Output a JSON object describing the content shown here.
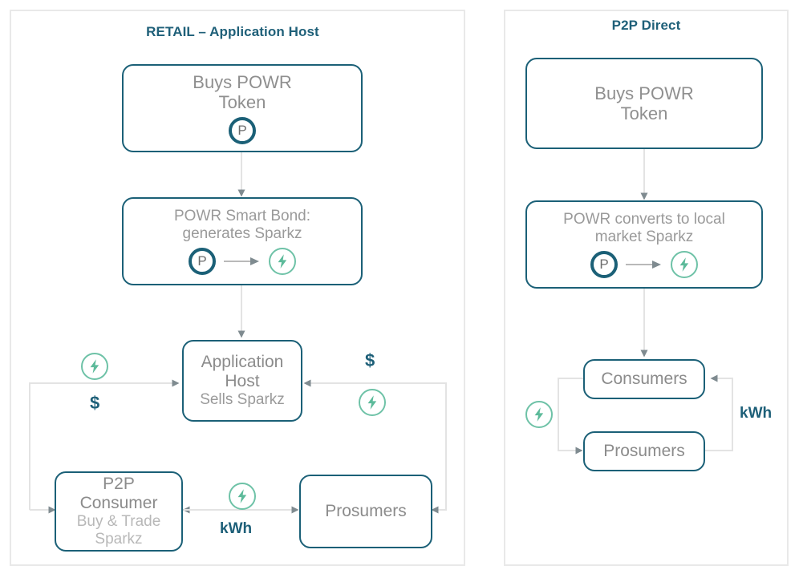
{
  "diagram": {
    "title_visible": false,
    "accent_dark_teal": "#1b6077",
    "accent_green": "#6ec2a7",
    "text_gray": "#8f8f8f",
    "text_gray_light": "#b4b4b4",
    "panel_border": "#e9e9e9"
  },
  "panels": [
    {
      "id": "retail",
      "title": "RETAIL – Application Host",
      "nodes": [
        {
          "name": "buys-powr-token",
          "text": "Buys POWR\nToken",
          "icons": [
            "powr-token-icon"
          ]
        },
        {
          "name": "powr-smart-bond",
          "text": "POWR Smart Bond:\ngenerates Sparkz",
          "icons": [
            "powr-token-icon",
            "arrow-right-icon",
            "sparkz-icon"
          ]
        },
        {
          "name": "application-host",
          "text": "Application\nHost",
          "subtext": "Sells Sparkz",
          "icons": []
        },
        {
          "name": "p2p-consumer",
          "text": "P2P\nConsumer",
          "subtext": "Buy & Trade\nSparkz",
          "icons": []
        },
        {
          "name": "prosumers",
          "text": "Prosumers",
          "icons": []
        }
      ],
      "edge_labels": [
        {
          "name": "edge-label-dollar-left",
          "text": "$"
        },
        {
          "name": "edge-label-dollar-right",
          "text": "$"
        },
        {
          "name": "edge-label-kwh",
          "text": "kWh"
        }
      ],
      "edge_icons": [
        {
          "name": "sparkz-icon-left-rail"
        },
        {
          "name": "sparkz-icon-right-rail"
        },
        {
          "name": "sparkz-icon-center-kwh"
        }
      ]
    },
    {
      "id": "p2p-direct",
      "title": "P2P Direct",
      "nodes": [
        {
          "name": "buys-powr-token",
          "text": "Buys POWR\nToken",
          "icons": []
        },
        {
          "name": "powr-converts",
          "text": "POWR converts to local\nmarket Sparkz",
          "icons": [
            "powr-token-icon",
            "arrow-right-icon",
            "sparkz-icon"
          ]
        },
        {
          "name": "consumers",
          "text": "Consumers",
          "icons": []
        },
        {
          "name": "prosumers",
          "text": "Prosumers",
          "icons": []
        }
      ],
      "edge_labels": [
        {
          "name": "edge-label-kwh",
          "text": "kWh"
        }
      ],
      "edge_icons": [
        {
          "name": "sparkz-icon-left-rail"
        }
      ]
    }
  ],
  "tokens": {
    "powr_letter": "P"
  }
}
